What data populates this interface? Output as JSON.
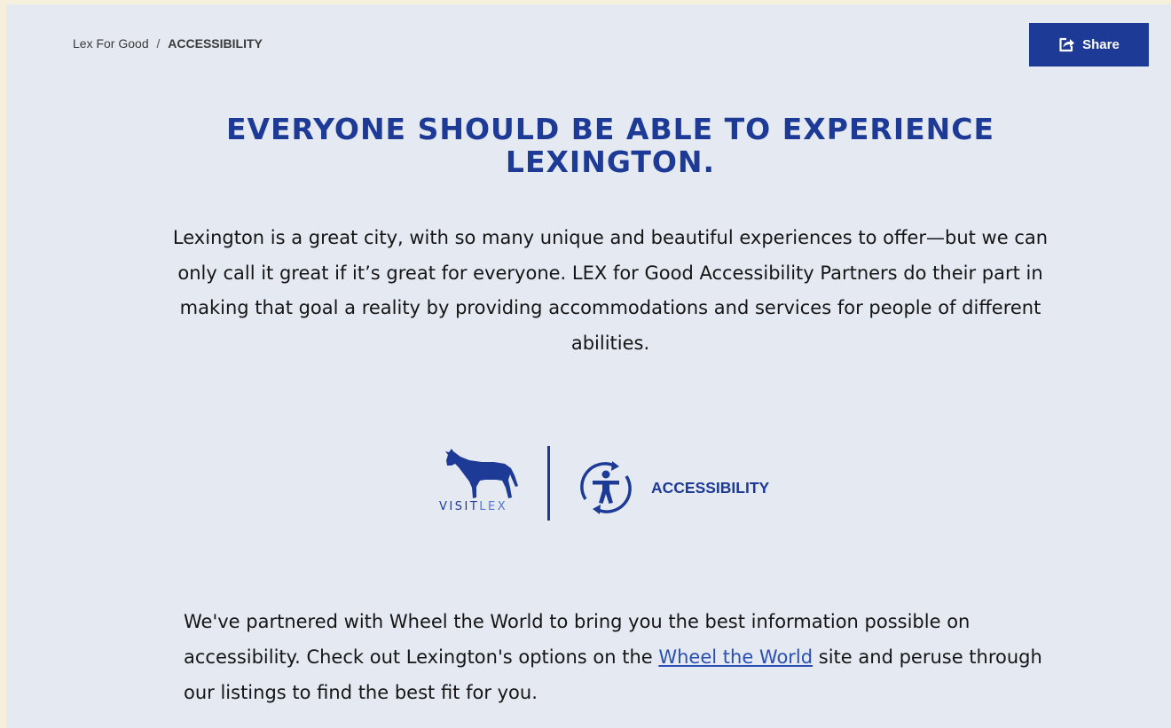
{
  "breadcrumb": {
    "parent": "Lex For Good",
    "separator": "/",
    "current": "ACCESSIBILITY"
  },
  "share": {
    "label": "Share",
    "icon": "share-icon"
  },
  "headline": "EVERYONE SHOULD BE ABLE TO EXPERIENCE LEXINGTON.",
  "intro": "Lexington is a great city, with so many unique and beautiful experiences to offer—but we can only call it great if it’s great for everyone. LEX for Good Accessibility Partners do their part in making that goal a reality by providing accommodations and services for people of different abilities.",
  "logo": {
    "brand_primary": "VISIT",
    "brand_secondary": "LEX",
    "badge_label": "ACCESSIBILITY",
    "horse_icon": "horse-icon",
    "accessibility_icon": "accessibility-icon"
  },
  "partner": {
    "text_before": "We've partnered with Wheel the World to bring you the best information possible on accessibility. Check out Lexington's options on the ",
    "link_text": "Wheel the World",
    "text_after": " site and peruse through our listings to find the best fit for you."
  },
  "colors": {
    "brand_blue": "#1e3a97",
    "link_blue": "#2a4fb4",
    "page_background": "#e5eaf2",
    "outer_background": "#f6efdc",
    "text": "#151515"
  }
}
